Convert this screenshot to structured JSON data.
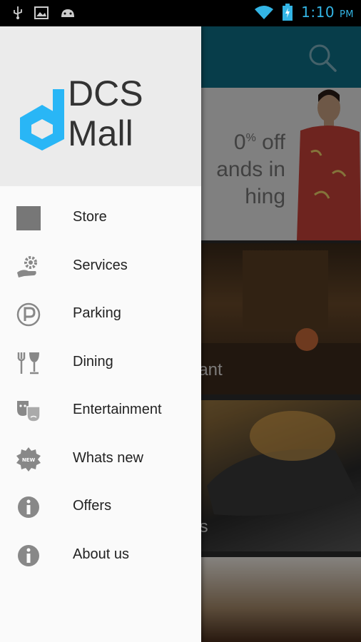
{
  "status_bar": {
    "time": "1:10",
    "ampm": "PM",
    "icons": [
      "usb-icon",
      "image-icon",
      "android-icon",
      "wifi-icon",
      "battery-charging-icon"
    ],
    "accent_color": "#33b5e5"
  },
  "app_bar": {
    "color": "#0e6f88",
    "search_icon": "search-icon"
  },
  "banner": {
    "line1_prefix": "0",
    "line1_sup": "%",
    "line1_suffix": " off",
    "line2": "ands in",
    "line3": "hing"
  },
  "tiles": [
    {
      "label": "Restaurant"
    },
    {
      "label": "Games"
    },
    {
      "label": ""
    }
  ],
  "drawer": {
    "logo_line1": "DCS",
    "logo_line2": "Mall",
    "logo_color": "#29b6f6",
    "items": [
      {
        "label": "Store",
        "icon": "store-square-icon"
      },
      {
        "label": "Services",
        "icon": "services-hand-gear-icon"
      },
      {
        "label": "Parking",
        "icon": "parking-icon"
      },
      {
        "label": "Dining",
        "icon": "dining-fork-glass-icon"
      },
      {
        "label": "Entertainment",
        "icon": "theater-masks-icon"
      },
      {
        "label": "Whats new",
        "icon": "new-badge-icon"
      },
      {
        "label": "Offers",
        "icon": "info-icon"
      },
      {
        "label": "About us",
        "icon": "info-icon"
      }
    ]
  }
}
